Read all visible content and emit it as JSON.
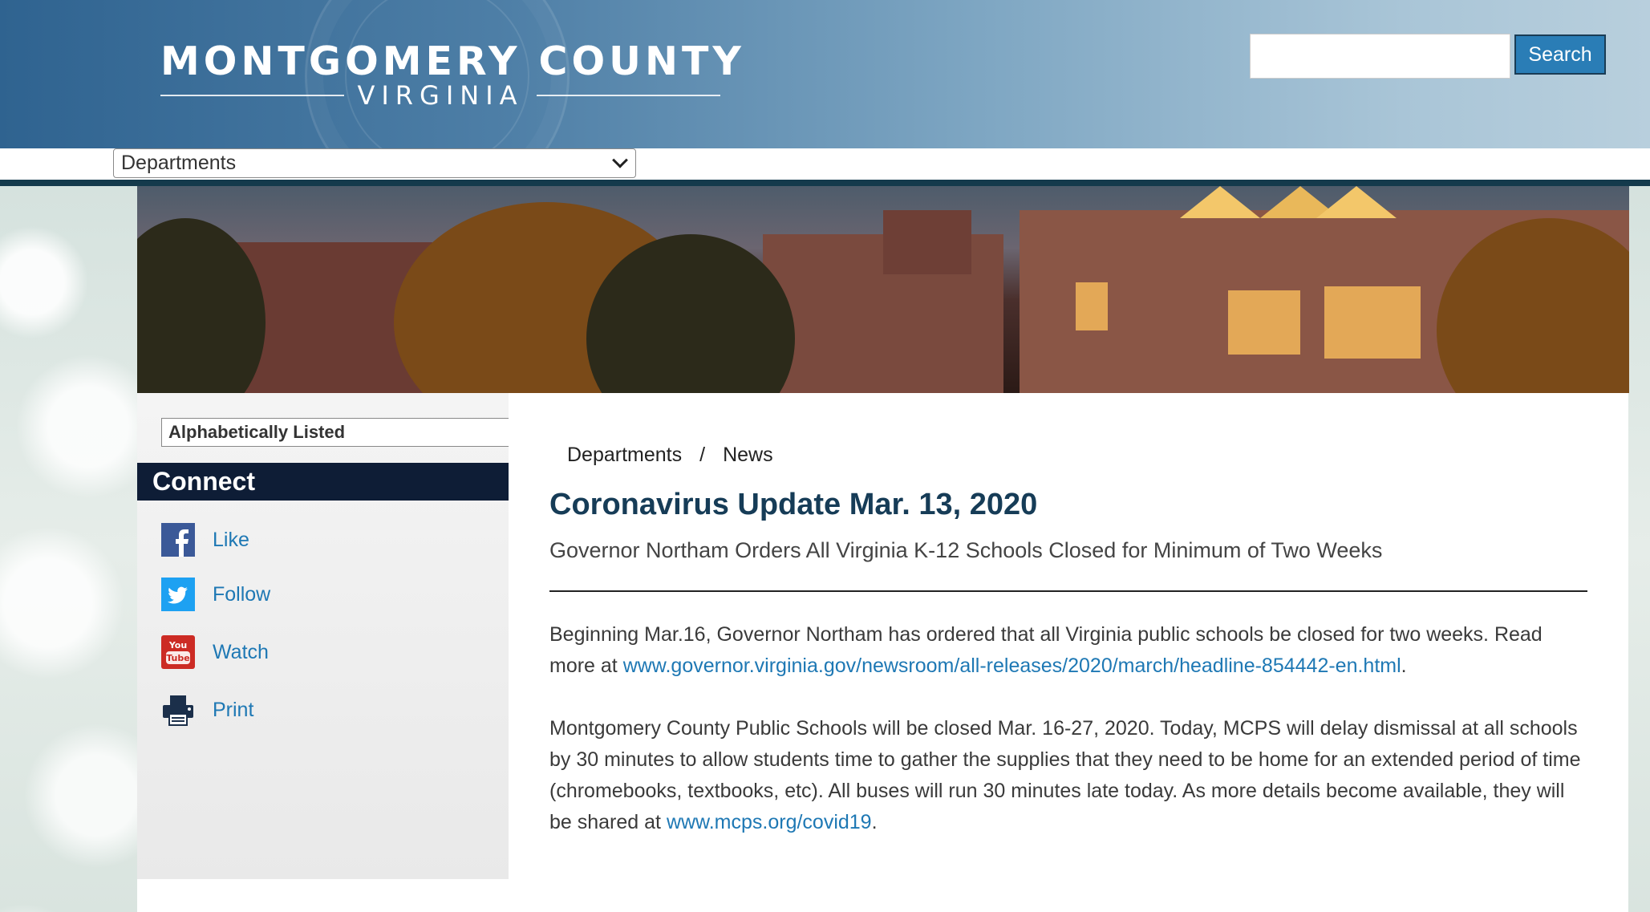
{
  "header": {
    "title": "MONTGOMERY COUNTY",
    "subtitle": "VIRGINIA",
    "search_placeholder": "",
    "search_label": "Search"
  },
  "nav": {
    "departments_label": "Departments"
  },
  "sidebar": {
    "alpha_label": "Alphabetically Listed",
    "connect_label": "Connect",
    "social": [
      {
        "label": "Like",
        "icon": "facebook-icon"
      },
      {
        "label": "Follow",
        "icon": "twitter-icon"
      },
      {
        "label": "Watch",
        "icon": "youtube-icon"
      },
      {
        "label": "Print",
        "icon": "printer-icon"
      }
    ]
  },
  "breadcrumb": {
    "items": [
      "Departments",
      "News"
    ],
    "separator": "/"
  },
  "article": {
    "title": "Coronavirus Update Mar. 13, 2020",
    "subtitle": "Governor Northam Orders All Virginia K-12 Schools Closed for Minimum of Two Weeks",
    "p1_text": "Beginning Mar.16, Governor Northam has ordered that all Virginia public schools be closed for two weeks. Read more at ",
    "p1_link": "www.governor.virginia.gov/newsroom/all-releases/2020/march/headline-854442-en.html",
    "p1_end": ".",
    "p2_text": "Montgomery County Public Schools will be closed Mar. 16-27, 2020. Today, MCPS will delay dismissal at all schools by 30 minutes to allow students time to gather the supplies that they need to be home for an extended period of time (chromebooks, textbooks, etc). All buses will run 30 minutes late today. As more details become available, they will be shared at ",
    "p2_link": "www.mcps.org/covid19",
    "p2_end": "."
  },
  "colors": {
    "accent_link": "#1e78b4",
    "title": "#163c57",
    "connect_bar": "#0e1d36",
    "search_button": "#2a7db6"
  }
}
